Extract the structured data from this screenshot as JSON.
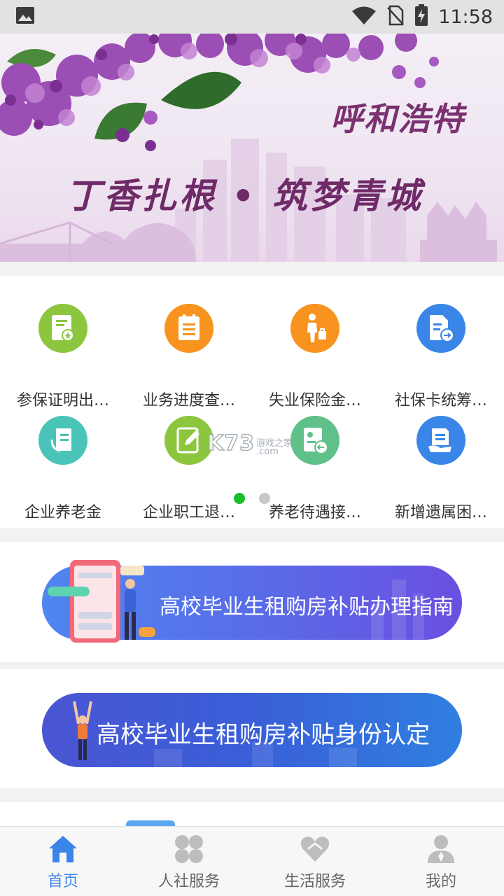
{
  "status_bar": {
    "time": "11:58"
  },
  "banner": {
    "city_name": "呼和浩特",
    "slogan": "丁香扎根 • 筑梦青城"
  },
  "services": [
    {
      "label": "参保证明出…",
      "icon": "certificate-icon",
      "color": "#8cc63f"
    },
    {
      "label": "业务进度查…",
      "icon": "progress-list-icon",
      "color": "#f7931e"
    },
    {
      "label": "失业保险金…",
      "icon": "unemployed-person-icon",
      "color": "#f7931e"
    },
    {
      "label": "社保卡统筹…",
      "icon": "card-transfer-icon",
      "color": "#3a86e8"
    },
    {
      "label": "企业养老金",
      "icon": "pension-document-icon",
      "color": "#4ac3b8"
    },
    {
      "label": "企业职工退…",
      "icon": "edit-note-icon",
      "color": "#8cc63f"
    },
    {
      "label": "养老待遇接…",
      "icon": "transfer-doc-icon",
      "color": "#5fc08a"
    },
    {
      "label": "新增遗属困…",
      "icon": "folder-hand-icon",
      "color": "#3a86e8"
    }
  ],
  "pager": {
    "active_index": 0,
    "page_count": 2
  },
  "watermark": {
    "brand": "K73",
    "sub": "游戏之家",
    "domain": ".com"
  },
  "banners": [
    {
      "title": "高校毕业生租购房补贴办理指南"
    },
    {
      "title": "高校毕业生租购房补贴身份认定"
    }
  ],
  "tabs": [
    {
      "label": "首页",
      "icon": "home-icon",
      "active": true
    },
    {
      "label": "人社服务",
      "icon": "clover-grid-icon",
      "active": false
    },
    {
      "label": "生活服务",
      "icon": "heart-icon",
      "active": false
    },
    {
      "label": "我的",
      "icon": "user-icon",
      "active": false
    }
  ],
  "colors": {
    "accent": "#3a86e8",
    "pager_active": "#1bbf2b"
  }
}
